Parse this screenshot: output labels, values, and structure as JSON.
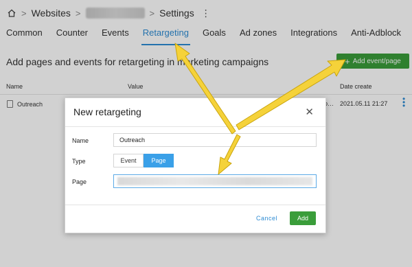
{
  "breadcrumb": {
    "home_icon": "home-icon",
    "item1": "Websites",
    "sep": ">",
    "item3": "Settings",
    "menu": "⋮"
  },
  "tabs": [
    "Common",
    "Counter",
    "Events",
    "Retargeting",
    "Goals",
    "Ad zones",
    "Integrations",
    "Anti-Adblock"
  ],
  "active_tab": "Retargeting",
  "section": {
    "title": "Add pages and events for retargeting in marketing campaigns",
    "add_button": "Add event/page",
    "add_plus": "+"
  },
  "table": {
    "headers": {
      "name": "Name",
      "value": "Value",
      "date": "Date create"
    },
    "rows": [
      {
        "name": "Outreach",
        "value_tail": "p…",
        "date": "2021.05.11 21:27"
      }
    ],
    "row_menu": "⋮"
  },
  "modal": {
    "title": "New retargeting",
    "close": "✕",
    "name_label": "Name",
    "name_value": "Outreach",
    "type_label": "Type",
    "type_options": [
      "Event",
      "Page"
    ],
    "type_selected": "Page",
    "page_label": "Page",
    "cancel": "Cancel",
    "add": "Add"
  },
  "colors": {
    "accent": "#2d8bd3",
    "green": "#3a9d3a",
    "toggle_active": "#3aa0e8",
    "arrow": "#f5d23a"
  }
}
